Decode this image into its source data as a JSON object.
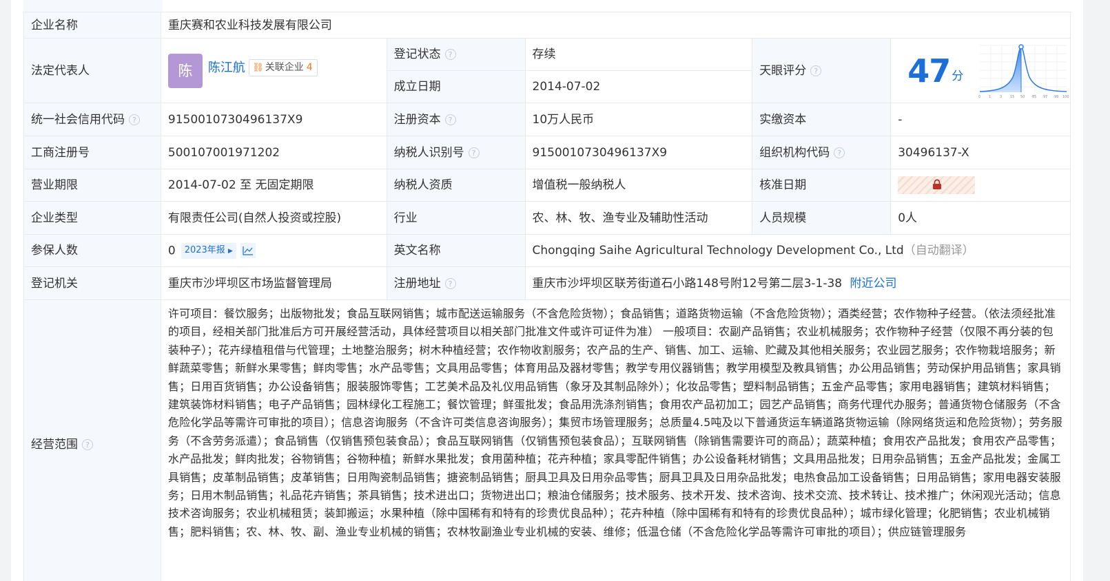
{
  "company": {
    "name_label": "企业名称",
    "name": "重庆赛和农业科技发展有限公司"
  },
  "legal_rep": {
    "label": "法定代表人",
    "avatar_char": "陈",
    "name": "陈江航",
    "related_label": "关联企业",
    "related_count": "4"
  },
  "status": {
    "label": "登记状态",
    "value": "存续"
  },
  "founded": {
    "label": "成立日期",
    "value": "2014-07-02"
  },
  "tianyan": {
    "label": "天眼评分",
    "score": "47",
    "unit": "分",
    "axis_ticks": [
      "0",
      "1",
      "3",
      "15",
      "50",
      "85",
      "97",
      "99",
      "100"
    ]
  },
  "credit_code": {
    "label": "统一社会信用代码",
    "value": "915001073049613­7X9"
  },
  "reg_capital": {
    "label": "注册资本",
    "value": "10万人民币"
  },
  "paid_capital": {
    "label": "实缴资本",
    "value": "-"
  },
  "reg_no": {
    "label": "工商注册号",
    "value": "500107001971202"
  },
  "taxpayer_id": {
    "label": "纳税人识别号",
    "value": "915001073049613­7X9"
  },
  "org_code": {
    "label": "组织机构代码",
    "value": "30496137-X"
  },
  "term": {
    "label": "营业期限",
    "value": "2014-07-02 至 无固定期限"
  },
  "taxpayer_qual": {
    "label": "纳税人资质",
    "value": "增值税一般纳税人"
  },
  "approve_date": {
    "label": "核准日期"
  },
  "company_type": {
    "label": "企业类型",
    "value": "有限责任公司(自然人投资或控股)"
  },
  "industry": {
    "label": "行业",
    "value": "农、林、牧、渔专业及辅助性活动"
  },
  "staff_size": {
    "label": "人员规模",
    "value": "0人"
  },
  "insured": {
    "label": "参保人数",
    "value": "0",
    "report_tag": "2023年报"
  },
  "english_name": {
    "label": "英文名称",
    "value": "Chongqing Saihe Agricultural Technology Development Co., Ltd",
    "note": "（自动翻译）"
  },
  "reg_authority": {
    "label": "登记机关",
    "value": "重庆市沙坪坝区市场监督管理局"
  },
  "reg_address": {
    "label": "注册地址",
    "value": "重庆市沙坪坝区联芳街道石小路148号附12号第二层3-1-38",
    "nearby": "附近公司"
  },
  "scope": {
    "label": "经营范围",
    "text": "许可项目：餐饮服务；出版物批发；食品互联网销售；城市配送运输服务（不含危险货物）；食品销售；道路货物运输（不含危险货物）；酒类经营；农作物种子经营。（依法须经批准的项目，经相关部门批准后方可开展经营活动，具体经营项目以相关部门批准文件或许可证件为准） 一般项目：农副产品销售；农业机械服务；农作物种子经营（仅限不再分装的包装种子）；花卉绿植租借与代管理；土地整治服务；树木种植经营；农作物收割服务；农产品的生产、销售、加工、运输、贮藏及其他相关服务；农业园艺服务；农作物栽培服务；新鲜蔬菜零售；新鲜水果零售；鲜肉零售；水产品零售；文具用品零售；体育用品及器材零售；教学专用仪器销售；教学用模型及教具销售；办公用品销售；劳动保护用品销售；家具销售；日用百货销售；办公设备销售；服装服饰零售；工艺美术品及礼仪用品销售（象牙及其制品除外）；化妆品零售；塑料制品销售；五金产品零售；家用电器销售；建筑材料销售；建筑装饰材料销售；电子产品销售；园林绿化工程施工；餐饮管理；鲜蛋批发；食品用洗涤剂销售；食用农产品初加工；园艺产品销售；商务代理代办服务；普通货物仓储服务（不含危险化学品等需许可审批的项目）；信息咨询服务（不含许可类信息咨询服务）；集贸市场管理服务；总质量4.5吨及以下普通货运车辆道路货物运输（除网络货运和危险货物）；劳务服务（不含劳务派遣）；食品销售（仅销售预包装食品）；食品互联网销售（仅销售预包装食品）；互联网销售（除销售需要许可的商品）；蔬菜种植；食用农产品批发；食用农产品零售；水产品批发；鲜肉批发；谷物销售；谷物种植；新鲜水果批发；食用菌种植；花卉种植；家具零配件销售；办公设备耗材销售；文具用品批发；日用杂品销售；五金产品批发；金属工具销售；皮革制品销售；皮革销售；日用陶瓷制品销售；搪瓷制品销售；厨具卫具及日用杂品零售；厨具卫具及日用杂品批发；电热食品加工设备销售；日用品销售；家用电器安装服务；日用木制品销售；礼品花卉销售；茶具销售；技术进出口；货物进出口；粮油仓储服务；技术服务、技术开发、技术咨询、技术交流、技术转让、技术推广；休闲观光活动；信息技术咨询服务；农业机械租赁；装卸搬运；水果种植（除中国稀有和特有的珍贵优良品种）；花卉种植（除中国稀有和特有的珍贵优良品种）；城市绿化管理；化肥销售；农业机械销售；肥料销售；农、林、牧、副、渔业专业机械的销售；农林牧副渔业专业机械的安装、维修；低温仓储（不含危险化学品等需许可审批的项目）；供应链管理服务"
  }
}
